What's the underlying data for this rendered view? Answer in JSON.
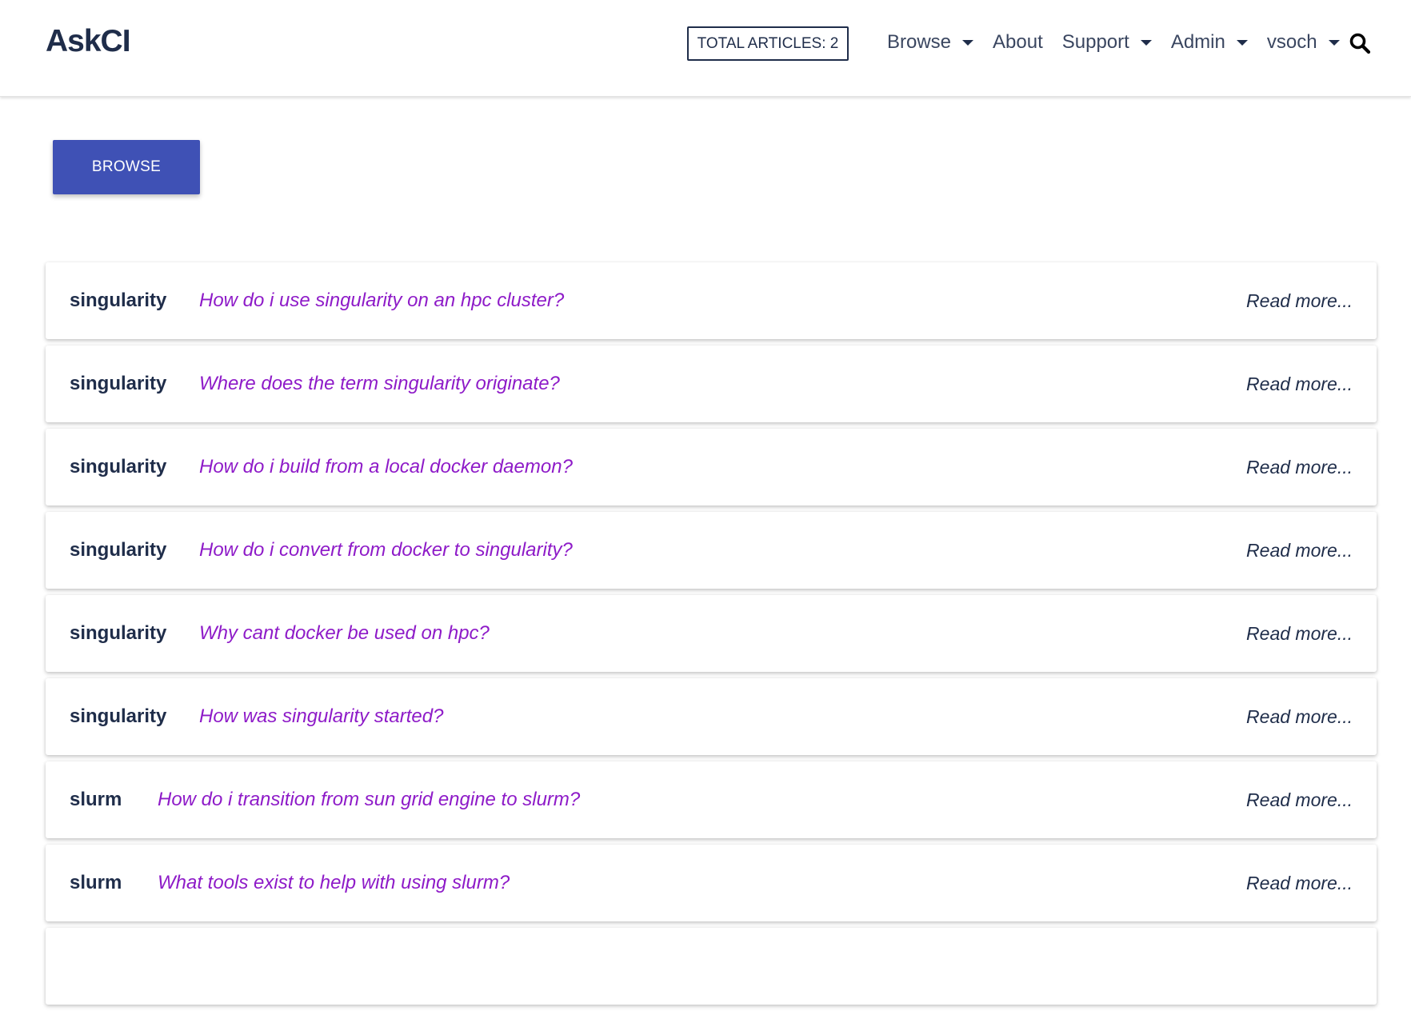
{
  "navbar": {
    "brand": "AskCI",
    "total_articles": "TOTAL ARTICLES: 2",
    "links": [
      {
        "label": "Browse",
        "dropdown": true
      },
      {
        "label": "About",
        "dropdown": false
      },
      {
        "label": "Support",
        "dropdown": true
      },
      {
        "label": "Admin",
        "dropdown": true
      },
      {
        "label": "vsoch",
        "dropdown": true
      }
    ],
    "search_icon": "search-icon"
  },
  "main": {
    "browse_button": "BROWSE",
    "articles": [
      {
        "tag": "singularity",
        "title": "How do i use singularity on an hpc cluster?",
        "read_more": "Read more..."
      },
      {
        "tag": "singularity",
        "title": "Where does the term singularity originate?",
        "read_more": "Read more..."
      },
      {
        "tag": "singularity",
        "title": "How do i build from a local docker daemon?",
        "read_more": "Read more..."
      },
      {
        "tag": "singularity",
        "title": "How do i convert from docker to singularity?",
        "read_more": "Read more..."
      },
      {
        "tag": "singularity",
        "title": "Why cant docker be used on hpc?",
        "read_more": "Read more..."
      },
      {
        "tag": "singularity",
        "title": "How was singularity started?",
        "read_more": "Read more..."
      },
      {
        "tag": "slurm",
        "title": "How do i transition from sun grid engine to slurm?",
        "read_more": "Read more..."
      },
      {
        "tag": "slurm",
        "title": "What tools exist to help with using slurm?",
        "read_more": "Read more..."
      },
      {
        "tag": "",
        "title": "",
        "read_more": ""
      }
    ]
  },
  "colors": {
    "primary_text": "#1f2d4a",
    "accent_button": "#3f51b5",
    "link_purple": "#8e1bc8"
  }
}
